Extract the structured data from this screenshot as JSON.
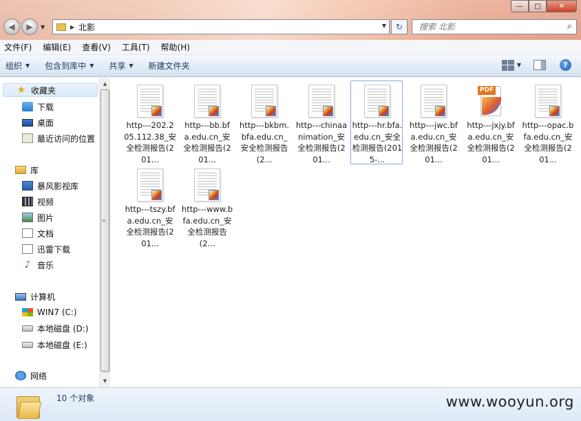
{
  "window": {
    "address_crumb": "北影",
    "search_placeholder": "搜索 北影"
  },
  "menu": [
    "文件(F)",
    "编辑(E)",
    "查看(V)",
    "工具(T)",
    "帮助(H)"
  ],
  "toolbar": {
    "organize": "组织",
    "include_in_library": "包含到库中",
    "share": "共享",
    "new_folder": "新建文件夹"
  },
  "nav": {
    "favorites": "收藏夹",
    "downloads": "下载",
    "desktop": "桌面",
    "recent": "最近访问的位置",
    "libraries": "库",
    "baofeng": "暴风影视库",
    "videos": "视频",
    "pictures": "图片",
    "documents": "文档",
    "thunder": "迅雷下载",
    "music": "音乐",
    "computer": "计算机",
    "drive_c": "WIN7 (C:)",
    "drive_d": "本地磁盘 (D:)",
    "drive_e": "本地磁盘 (E:)",
    "network": "网络"
  },
  "files": [
    {
      "name": "http---202.205.112.38_安全检测报告(201...",
      "type": "report",
      "selected": false
    },
    {
      "name": "http---bb.bfa.edu.cn_安全检测报告(201...",
      "type": "report",
      "selected": false
    },
    {
      "name": "http---bkbm.bfa.edu.cn_安全检测报告(2...",
      "type": "report",
      "selected": false
    },
    {
      "name": "http---chinaanimation_安全检测报告(201...",
      "type": "report",
      "selected": false
    },
    {
      "name": "http---hr.bfa.edu.cn_安全检测报告(2015-...",
      "type": "report",
      "selected": true
    },
    {
      "name": "http---jwc.bfa.edu.cn_安全检测报告(201...",
      "type": "report",
      "selected": false
    },
    {
      "name": "http---jxjy.bfa.edu.cn_安全检测报告(201...",
      "type": "pdf",
      "selected": false
    },
    {
      "name": "http---opac.bfa.edu.cn_安全检测报告(201...",
      "type": "report",
      "selected": false
    },
    {
      "name": "http---tszy.bfa.edu.cn_安全检测报告(201...",
      "type": "report",
      "selected": false
    },
    {
      "name": "http---www.bfa.edu.cn_安全检测报告(2...",
      "type": "report",
      "selected": false
    }
  ],
  "pdf_label": "PDF",
  "status": {
    "item_count": "10 个对象",
    "watermark": "www.wooyun.org"
  }
}
